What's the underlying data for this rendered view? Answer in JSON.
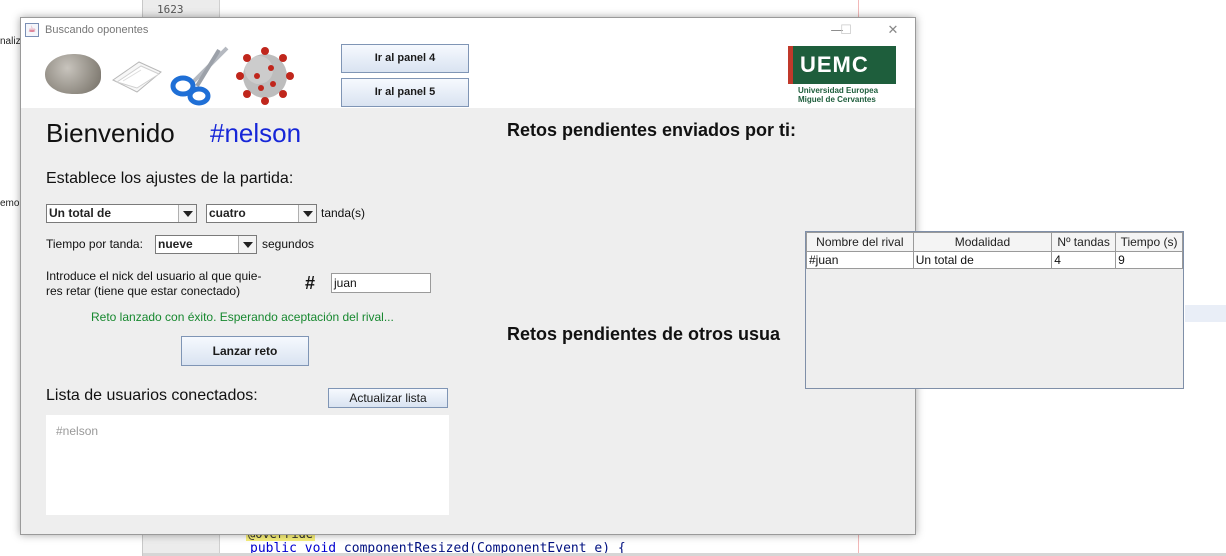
{
  "ide": {
    "line_number": "1623",
    "left_fragments": [
      "naliz",
      "emo"
    ],
    "bottom_code_kw": "public void",
    "bottom_code_rest": " componentResized(ComponentEvent e) {",
    "override_marker": "@Override"
  },
  "window": {
    "title": "Buscando oponentes",
    "buttons": {
      "minimize": "—",
      "maximize": "☐",
      "close": "✕"
    }
  },
  "header": {
    "icons": [
      "rock-icon",
      "paper-icon",
      "scissors-icon",
      "virus-icon"
    ],
    "panel4_label": "Ir al panel 4",
    "panel5_label": "Ir al panel 5",
    "logo": {
      "main": "UEMC",
      "line1": "Universidad Europea",
      "line2": "Miguel de Cervantes",
      "color": "#1e5e3c",
      "accent": "#c0392b"
    }
  },
  "welcome": {
    "text": "Bienvenido",
    "user": "#nelson"
  },
  "settings": {
    "heading": "Establece los ajustes de la partida:",
    "mode_value": "Un total de",
    "rounds_value": "cuatro",
    "rounds_suffix": "tanda(s)",
    "time_label": "Tiempo por tanda:",
    "time_value": "nueve",
    "time_suffix": "segundos",
    "nick_label_line1": "Introduce el nick del usuario al que quie-",
    "nick_label_line2": "res retar (tiene que estar conectado)",
    "hash": "#",
    "nick_value": "juan",
    "status": "Reto lanzado con éxito. Esperando aceptación del rival...",
    "status_color": "#17882f",
    "launch_label": "Lanzar reto"
  },
  "users": {
    "heading": "Lista de usuarios conectados:",
    "refresh_label": "Actualizar lista",
    "items": [
      "#nelson"
    ]
  },
  "challenges": {
    "sent_heading": "Retos pendientes enviados por ti:",
    "received_heading": "Retos pendientes de otros usua",
    "table": {
      "columns": [
        "Nombre del rival",
        "Modalidad",
        "Nº tandas",
        "Tiempo (s)"
      ],
      "rows": [
        [
          "#juan",
          "Un total de",
          "4",
          "9"
        ]
      ]
    }
  }
}
